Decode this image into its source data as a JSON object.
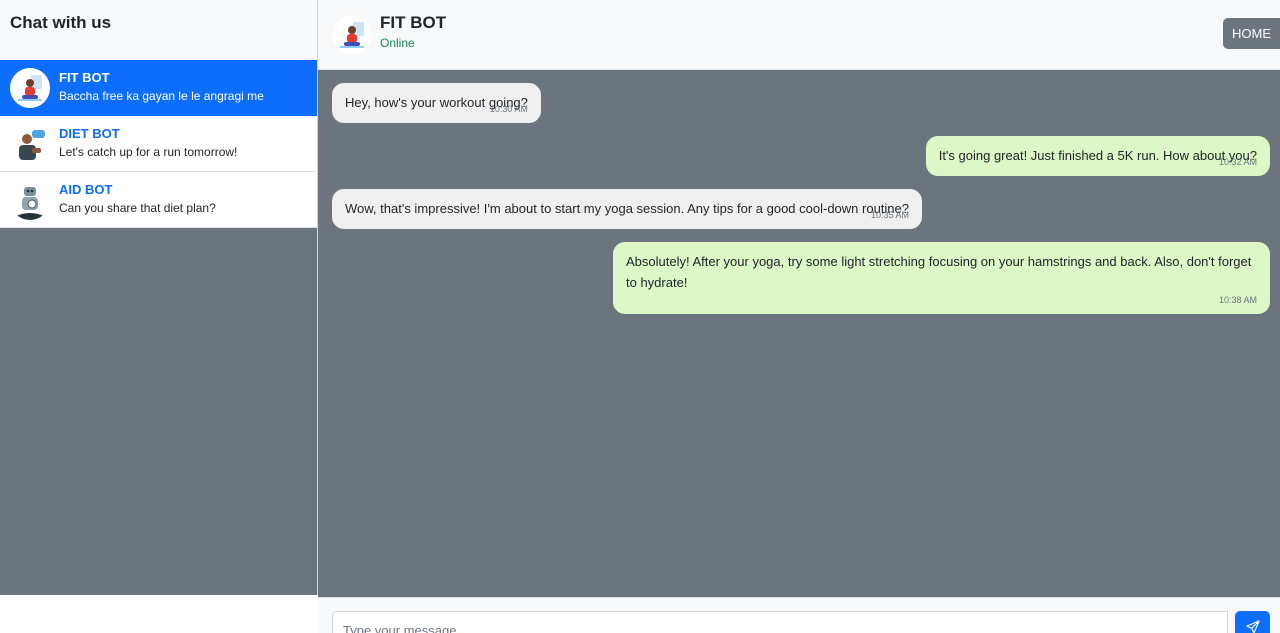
{
  "sidebar": {
    "title": "Chat with us",
    "contacts": [
      {
        "name": "FIT BOT",
        "preview": "Baccha free ka gayan le le angragi me",
        "active": true
      },
      {
        "name": "DIET BOT",
        "preview": "Let's catch up for a run tomorrow!",
        "active": false
      },
      {
        "name": "AID BOT",
        "preview": "Can you share that diet plan?",
        "active": false
      }
    ]
  },
  "chat_header": {
    "name": "FIT BOT",
    "status": "Online",
    "home_label": "HOME"
  },
  "messages": [
    {
      "direction": "incoming",
      "text": "Hey, how's your workout going?",
      "time": "10:30 AM"
    },
    {
      "direction": "outgoing",
      "text": "It's going great! Just finished a 5K run. How about you?",
      "time": "10:32 AM"
    },
    {
      "direction": "incoming",
      "text": "Wow, that's impressive! I'm about to start my yoga session. Any tips for a good cool-down routine?",
      "time": "10:35 AM"
    },
    {
      "direction": "outgoing",
      "text": "Absolutely! After your yoga, try some light stretching focusing on your hamstrings and back. Also, don't forget to hydrate!",
      "time": "10:38 AM"
    }
  ],
  "composer": {
    "placeholder": "Type your message...",
    "send_icon": "paper-plane-icon"
  },
  "colors": {
    "accent": "#0d6efd",
    "panel_gray": "#6c757d",
    "incoming_bubble": "#f1f0f0",
    "outgoing_bubble": "#dcf8c6",
    "online": "#198754"
  }
}
